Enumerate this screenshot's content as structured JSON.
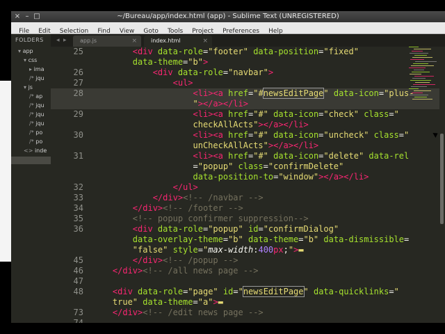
{
  "window": {
    "title": "~/Bureau/app/index.html (app) - Sublime Text (UNREGISTERED)",
    "controls": [
      "×",
      "–",
      "□"
    ]
  },
  "menu": [
    "File",
    "Edit",
    "Selection",
    "Find",
    "View",
    "Goto",
    "Tools",
    "Project",
    "Preferences",
    "Help"
  ],
  "sidebar": {
    "header": "FOLDERS",
    "items": [
      {
        "label": "app",
        "arrow": "▾"
      },
      {
        "label": "css",
        "arrow": "▾"
      },
      {
        "label": "ima",
        "arrow": "▸"
      },
      {
        "label": "jqu",
        "arrow": "/*"
      },
      {
        "label": "js",
        "arrow": "▾"
      },
      {
        "label": "ap",
        "arrow": "/*"
      },
      {
        "label": "jqu",
        "arrow": "/*"
      },
      {
        "label": "jqu",
        "arrow": "/*"
      },
      {
        "label": "jqu",
        "arrow": "/*"
      },
      {
        "label": "po",
        "arrow": "/*"
      },
      {
        "label": "po",
        "arrow": "/*"
      },
      {
        "label": "inde",
        "arrow": "<>"
      }
    ]
  },
  "tabs": [
    {
      "label": "app.js",
      "close": "×"
    },
    {
      "label": "index.html",
      "close": "×"
    }
  ],
  "nav": {
    "back": "◂",
    "forward": "▸"
  },
  "gutter": [
    "25",
    "",
    "26",
    "27",
    "28",
    "",
    "29",
    "",
    "30",
    "",
    "31",
    "",
    "",
    "32",
    "33",
    "34",
    "35",
    "36",
    "",
    "",
    "45",
    "46",
    "47",
    "48",
    "",
    "73",
    "74"
  ],
  "code": [
    [
      [
        "p",
        "        "
      ],
      [
        "t",
        "<div"
      ],
      [
        "a",
        " data-role"
      ],
      [
        "p",
        "="
      ],
      [
        "s",
        "\"footer\""
      ],
      [
        "a",
        " data-position"
      ],
      [
        "p",
        "="
      ],
      [
        "s",
        "\"fixed\""
      ]
    ],
    [
      [
        "a",
        "        data-theme"
      ],
      [
        "p",
        "="
      ],
      [
        "s",
        "\"b\""
      ],
      [
        "t",
        ">"
      ]
    ],
    [
      [
        "p",
        "            "
      ],
      [
        "t",
        "<div"
      ],
      [
        "a",
        " data-role"
      ],
      [
        "p",
        "="
      ],
      [
        "s",
        "\"navbar\""
      ],
      [
        "t",
        ">"
      ]
    ],
    [
      [
        "p",
        "                "
      ],
      [
        "t",
        "<ul"
      ],
      [
        "t",
        ">"
      ]
    ],
    [
      [
        "p",
        "                    "
      ],
      [
        "t",
        "<li"
      ],
      [
        "t",
        "><a"
      ],
      [
        "a",
        " href"
      ],
      [
        "p",
        "="
      ],
      [
        "s",
        "\"#"
      ],
      [
        "s",
        "newsEditPage",
        "hl"
      ],
      [
        "s",
        "\""
      ],
      [
        "a",
        " data-icon"
      ],
      [
        "p",
        "="
      ],
      [
        "s",
        "\"plus-"
      ]
    ],
    [
      [
        "s",
        "                    \""
      ],
      [
        "t",
        "></a></li>"
      ]
    ],
    [
      [
        "p",
        "                    "
      ],
      [
        "t",
        "<li"
      ],
      [
        "t",
        "><a"
      ],
      [
        "a",
        " href"
      ],
      [
        "p",
        "="
      ],
      [
        "s",
        "\"#\""
      ],
      [
        "a",
        " data-icon"
      ],
      [
        "p",
        "="
      ],
      [
        "s",
        "\"check\""
      ],
      [
        "a",
        " class"
      ],
      [
        "p",
        "="
      ],
      [
        "s",
        "\""
      ]
    ],
    [
      [
        "s",
        "                    checkAllActs\""
      ],
      [
        "t",
        "></a></li>"
      ]
    ],
    [
      [
        "p",
        "                    "
      ],
      [
        "t",
        "<li"
      ],
      [
        "t",
        "><a"
      ],
      [
        "a",
        " href"
      ],
      [
        "p",
        "="
      ],
      [
        "s",
        "\"#\""
      ],
      [
        "a",
        " data-icon"
      ],
      [
        "p",
        "="
      ],
      [
        "s",
        "\"uncheck\""
      ],
      [
        "a",
        " class"
      ],
      [
        "p",
        "="
      ],
      [
        "s",
        "\""
      ]
    ],
    [
      [
        "s",
        "                    unCheckAllActs\""
      ],
      [
        "t",
        "></a></li>"
      ]
    ],
    [
      [
        "p",
        "                    "
      ],
      [
        "t",
        "<li"
      ],
      [
        "t",
        "><a"
      ],
      [
        "a",
        " href"
      ],
      [
        "p",
        "="
      ],
      [
        "s",
        "\"#\""
      ],
      [
        "a",
        " data-icon"
      ],
      [
        "p",
        "="
      ],
      [
        "s",
        "\"delete\""
      ],
      [
        "a",
        " data-rel"
      ]
    ],
    [
      [
        "p",
        "                    ="
      ],
      [
        "s",
        "\"popup\""
      ],
      [
        "a",
        " class"
      ],
      [
        "p",
        "="
      ],
      [
        "s",
        "\"confirmDelete\""
      ]
    ],
    [
      [
        "a",
        "                    data-position-to"
      ],
      [
        "p",
        "="
      ],
      [
        "s",
        "\"window\""
      ],
      [
        "t",
        "></a></li>"
      ]
    ],
    [
      [
        "p",
        "                "
      ],
      [
        "t",
        "</ul>"
      ]
    ],
    [
      [
        "p",
        "            "
      ],
      [
        "t",
        "</div>"
      ],
      [
        "c",
        "<!-- /navbar -->"
      ]
    ],
    [
      [
        "p",
        "        "
      ],
      [
        "t",
        "</div>"
      ],
      [
        "c",
        "<!-- /footer -->"
      ]
    ],
    [
      [
        "c",
        "        <!-- popup confirmer suppression-->"
      ]
    ],
    [
      [
        "p",
        "        "
      ],
      [
        "t",
        "<div"
      ],
      [
        "a",
        " data-role"
      ],
      [
        "p",
        "="
      ],
      [
        "s",
        "\"popup\""
      ],
      [
        "a",
        " id"
      ],
      [
        "p",
        "="
      ],
      [
        "s",
        "\"confirmDialog\""
      ]
    ],
    [
      [
        "a",
        "        data-overlay-theme"
      ],
      [
        "p",
        "="
      ],
      [
        "s",
        "\"b\""
      ],
      [
        "a",
        " data-theme"
      ],
      [
        "p",
        "="
      ],
      [
        "s",
        "\"b\""
      ],
      [
        "a",
        " data-dismissible"
      ],
      [
        "p",
        "="
      ]
    ],
    [
      [
        "s",
        "        \"false\""
      ],
      [
        "a",
        " style"
      ],
      [
        "p",
        "="
      ],
      [
        "s",
        "\""
      ],
      [
        "p",
        "max-width",
        "it"
      ],
      [
        "p",
        ":"
      ],
      [
        "n",
        "400"
      ],
      [
        "t",
        "px"
      ],
      [
        "p",
        ";"
      ],
      [
        "s",
        "\""
      ],
      [
        "t",
        ">"
      ],
      [
        "s",
        "▬",
        "fold"
      ]
    ],
    [
      [
        "p",
        "        "
      ],
      [
        "t",
        "</div>"
      ],
      [
        "c",
        "<!-- /popup -->"
      ]
    ],
    [
      [
        "p",
        "    "
      ],
      [
        "t",
        "</div>"
      ],
      [
        "c",
        "<!-- /all news page -->"
      ]
    ],
    [
      [
        "p",
        ""
      ]
    ],
    [
      [
        "p",
        "    "
      ],
      [
        "t",
        "<div"
      ],
      [
        "a",
        " data-role"
      ],
      [
        "p",
        "="
      ],
      [
        "s",
        "\"page\""
      ],
      [
        "a",
        " id"
      ],
      [
        "p",
        "="
      ],
      [
        "s",
        "\""
      ],
      [
        "s",
        "newsEditPage",
        "hl"
      ],
      [
        "s",
        "\""
      ],
      [
        "a",
        " data-quicklinks"
      ],
      [
        "p",
        "="
      ],
      [
        "s",
        "\""
      ]
    ],
    [
      [
        "s",
        "    true\""
      ],
      [
        "a",
        " data-theme"
      ],
      [
        "p",
        "="
      ],
      [
        "s",
        "\"a\""
      ],
      [
        "t",
        ">"
      ],
      [
        "s",
        "▬",
        "fold"
      ]
    ],
    [
      [
        "p",
        "    "
      ],
      [
        "t",
        "</div>"
      ],
      [
        "c",
        "<!-- /edit news page -->"
      ]
    ],
    [
      [
        "p",
        ""
      ]
    ]
  ],
  "colors": {
    "background": "#272822",
    "tag": "#f92672",
    "attr": "#a6e22e",
    "string": "#e6db74",
    "comment": "#75715e"
  }
}
